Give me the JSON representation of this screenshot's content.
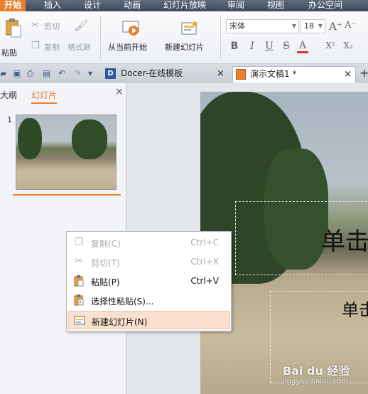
{
  "menu": [
    "开始",
    "插入",
    "设计",
    "动画",
    "幻灯片放映",
    "审阅",
    "视图",
    "办公空间"
  ],
  "ribbon": {
    "paste": "粘贴",
    "cut": "剪切",
    "copy": "复制",
    "format_painter": "格式刷",
    "from_current": "从当前开始",
    "new_slide": "新建幻灯片",
    "font_name": "宋体",
    "font_size": "18",
    "bold": "B",
    "italic": "I",
    "underline": "U",
    "strike": "S",
    "font_color": "A",
    "superscript": "X²",
    "subscript": "X₂",
    "grow": "A⁺",
    "shrink": "A⁻"
  },
  "tabs": {
    "docer": "Docer-在线模板",
    "doc": "演示文稿1 *",
    "add": "+"
  },
  "panel": {
    "outline": "大纲",
    "slides": "幻灯片",
    "slide_number": "1",
    "close": "×"
  },
  "slide": {
    "title_fragment": "单击",
    "subtitle_fragment": "单击"
  },
  "context_menu": [
    {
      "label": "复制(C)",
      "shortcut": "Ctrl+C",
      "icon": "copy-icon",
      "enabled": false
    },
    {
      "label": "剪切(T)",
      "shortcut": "Ctrl+X",
      "icon": "scissors-icon",
      "enabled": false
    },
    {
      "label": "粘贴(P)",
      "shortcut": "Ctrl+V",
      "icon": "paste-icon",
      "enabled": true
    },
    {
      "label": "选择性粘贴(S)...",
      "shortcut": "",
      "icon": "paste-special-icon",
      "enabled": true
    },
    {
      "label": "新建幻灯片(N)",
      "shortcut": "",
      "icon": "new-slide-icon",
      "enabled": true,
      "highlighted": true
    }
  ],
  "watermark": {
    "brand": "Bai du 经验",
    "url": "jingyan.baidu.com"
  },
  "colors": {
    "accent": "#e9812f",
    "menubar": "#4a5666",
    "highlight": "#fbe0cf"
  }
}
